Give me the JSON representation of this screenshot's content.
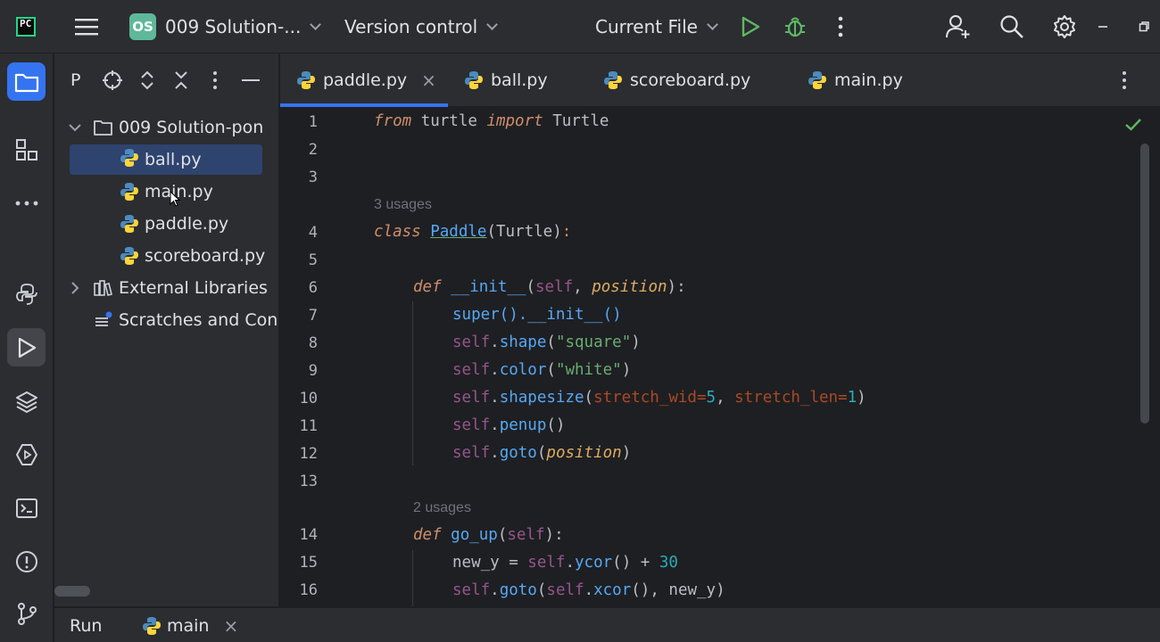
{
  "titlebar": {
    "app_logo_text": "PC",
    "project_badge": "OS",
    "project_name": "009 Solution-...",
    "vcs_label": "Version control",
    "run_config": "Current File"
  },
  "project_panel": {
    "header_label": "P",
    "tree": [
      {
        "label": "009 Solution-pon",
        "kind": "folder",
        "expanded": true
      },
      {
        "label": "ball.py",
        "kind": "python",
        "selected": true
      },
      {
        "label": "main.py",
        "kind": "python"
      },
      {
        "label": "paddle.py",
        "kind": "python"
      },
      {
        "label": "scoreboard.py",
        "kind": "python"
      },
      {
        "label": "External Libraries",
        "kind": "library",
        "expanded": false
      },
      {
        "label": "Scratches and Con",
        "kind": "scratch"
      }
    ]
  },
  "tabs": [
    {
      "label": "paddle.py",
      "active": true,
      "closable_glyph": "×"
    },
    {
      "label": "ball.py"
    },
    {
      "label": "scoreboard.py"
    },
    {
      "label": "main.py"
    }
  ],
  "editor": {
    "line_numbers": [
      "1",
      "2",
      "3",
      "4",
      "5",
      "6",
      "7",
      "8",
      "9",
      "10",
      "11",
      "12",
      "13",
      "14",
      "15",
      "16"
    ],
    "hints": {
      "class_usages": "3 usages",
      "goup_usages": "2 usages"
    },
    "tokens": {
      "from": "from",
      "turtle_mod": " turtle ",
      "import": "import",
      "Turtle": " Turtle",
      "class": "class",
      "Paddle": "Paddle",
      "paren_Turtle": "(Turtle)",
      "colon": ":",
      "def": "def",
      "init": "__init__",
      "open_self": "(",
      "self": "self",
      "comma_space": ", ",
      "position": "position",
      "close_colon": "):",
      "super_init": "super().__init__()",
      "dot": ".",
      "shape": "shape",
      "square": "\"square\"",
      "color": "color",
      "white": "\"white\"",
      "shapesize": "shapesize",
      "stretch_wid": "stretch_wid",
      "eq": "=",
      "five": "5",
      "stretch_len": "stretch_len",
      "one": "1",
      "penup": "penup",
      "goto": "goto",
      "go_up": "go_up",
      "new_y": "new_y",
      "eq_sp": " = ",
      "ycor": "ycor",
      "plus": " + ",
      "thirty": "30",
      "xcor": "xcor",
      "call": "()",
      "lp": "(",
      "rp": ")",
      "new_y_close": ", new_y)"
    }
  },
  "bottombar": {
    "run_label": "Run",
    "run_tab": "main",
    "close_glyph": "×"
  },
  "colors": {
    "accent": "#3574f0",
    "python_blue": "#4b8bbe",
    "python_yellow": "#ffd43b",
    "check_green": "#5fb865"
  }
}
